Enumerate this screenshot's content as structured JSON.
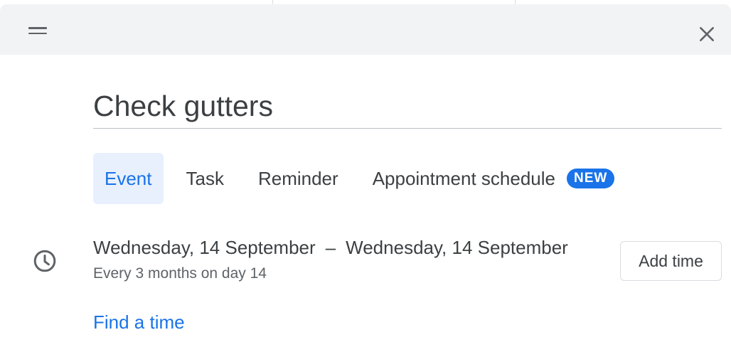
{
  "header": {
    "drag_icon": "drag-handle-icon",
    "close_icon": "close-icon"
  },
  "event": {
    "title": "Check gutters"
  },
  "tabs": [
    {
      "label": "Event",
      "active": true
    },
    {
      "label": "Task",
      "active": false
    },
    {
      "label": "Reminder",
      "active": false
    },
    {
      "label": "Appointment schedule",
      "active": false,
      "badge": "NEW"
    }
  ],
  "datetime": {
    "icon": "clock-icon",
    "start_date": "Wednesday, 14 September",
    "separator": "–",
    "end_date": "Wednesday, 14 September",
    "recurrence": "Every 3 months on day 14",
    "add_time_label": "Add time"
  },
  "find_time_label": "Find a time",
  "colors": {
    "accent": "#1a73e8",
    "active_tab_bg": "#e8f0fe",
    "header_bg": "#f1f3f4",
    "text_primary": "#3c4043",
    "text_secondary": "#5f6368"
  }
}
